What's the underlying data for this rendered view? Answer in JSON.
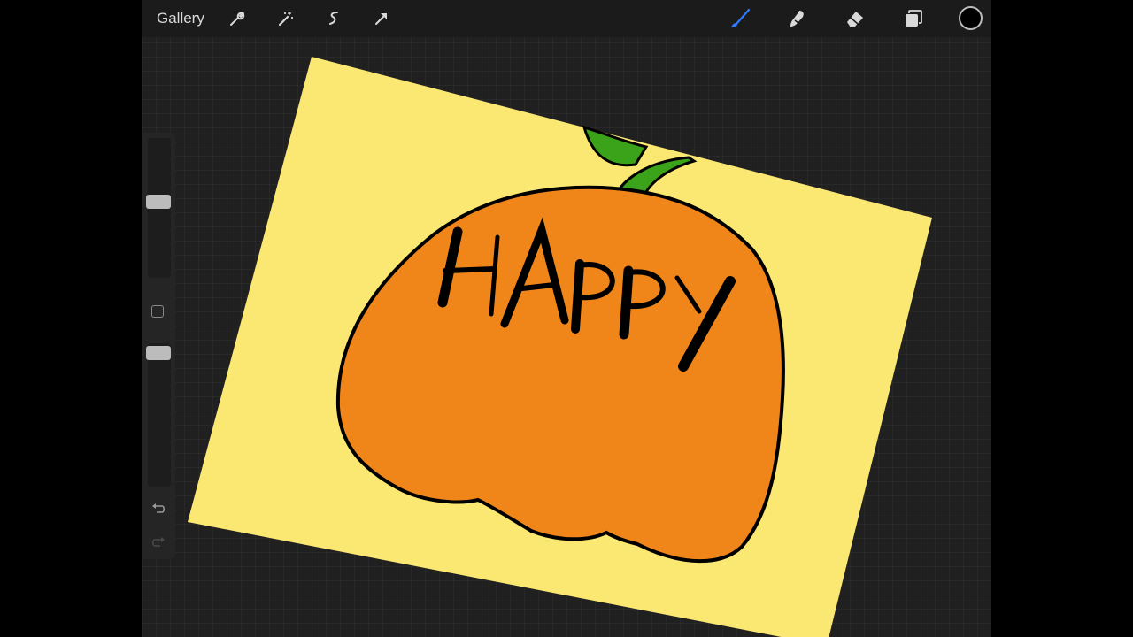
{
  "topbar": {
    "gallery_label": "Gallery",
    "tools_left": [
      "wrench-icon",
      "magic-wand-icon",
      "selection-icon",
      "transform-arrow-icon"
    ],
    "tools_right": [
      "brush-icon",
      "smudge-icon",
      "eraser-icon",
      "layers-icon"
    ],
    "active_tool": "brush",
    "current_color": "#000000",
    "accent_color": "#2f7bff"
  },
  "sidebar": {
    "brush_size": 0.55,
    "brush_opacity": 0.98,
    "buttons": [
      "modify-square-icon",
      "undo-icon",
      "redo-icon"
    ]
  },
  "artwork": {
    "text": "HAPPY",
    "paper_color": "#fbe873",
    "pumpkin_color": "#f08519",
    "stem_color": "#3aa319",
    "outline_color": "#000000"
  }
}
